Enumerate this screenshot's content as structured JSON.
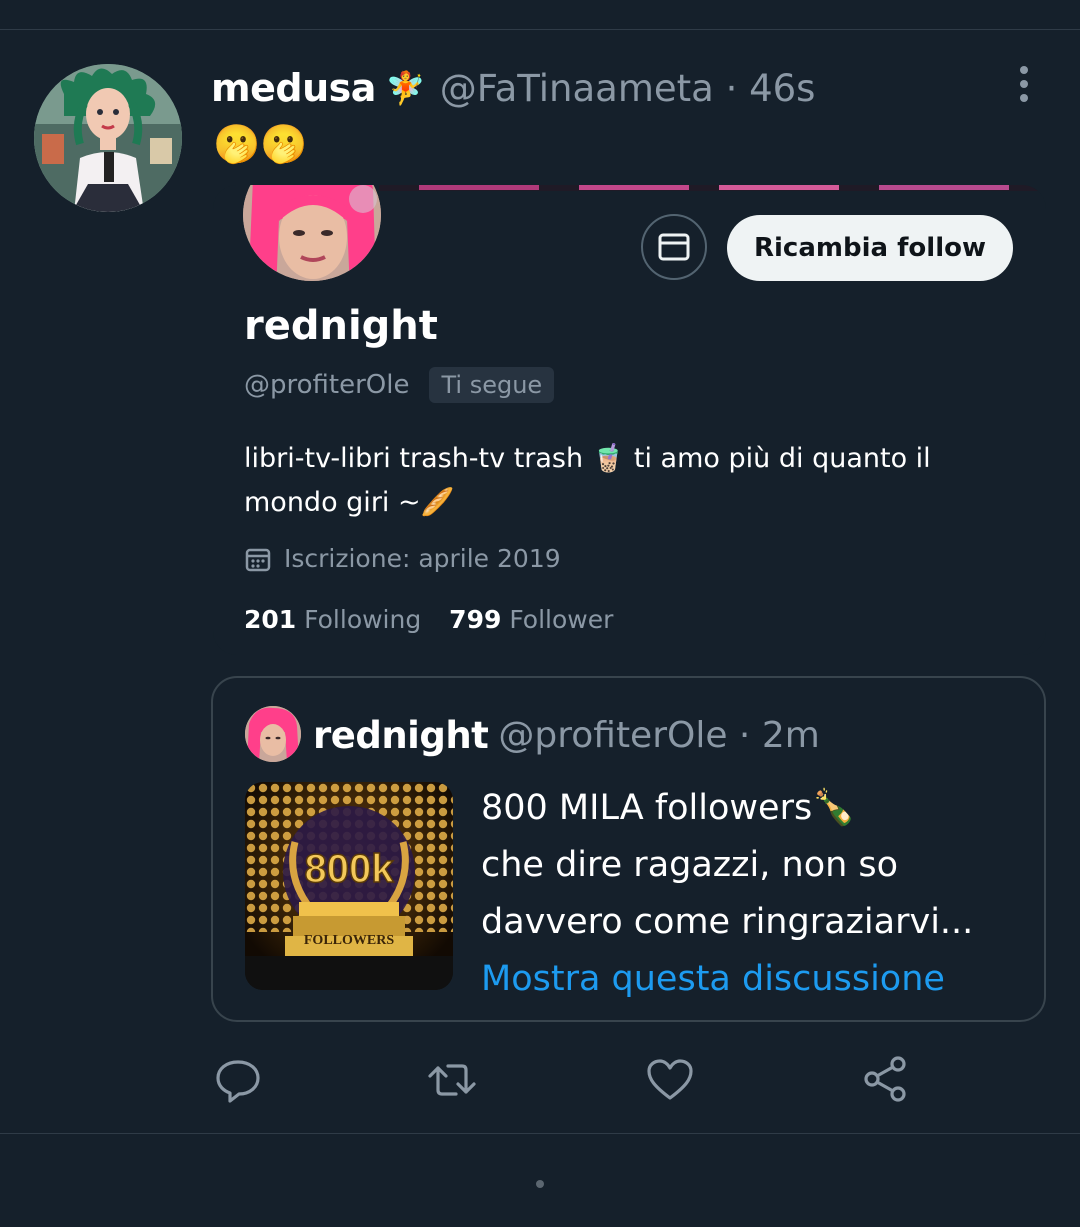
{
  "tweet": {
    "author_name": "medusa",
    "author_emoji": "🧚",
    "handle_time": "@FaTinaameta · 46s",
    "text": "🫢🫢",
    "more_icon": "more-vertical-icon"
  },
  "profile_card": {
    "name": "rednight",
    "handle": "@profiterOle",
    "follows_you": "Ti segue",
    "follow_button": "Ricambia follow",
    "message_icon": "envelope-icon",
    "bio": "libri-tv-libri trash-tv trash 🧋 ti amo più di quanto il mondo giri ~🥖",
    "joined": "Iscrizione: aprile 2019",
    "following_count": "201",
    "following_label": "Following",
    "followers_count": "799",
    "followers_label": "Follower"
  },
  "quoted_tweet": {
    "author_name": "rednight",
    "handle_time": "@profiterOle · 2m",
    "media_text_big": "800k",
    "media_text_small": "FOLLOWERS",
    "line1": "800 MILA followers🍾",
    "line2": "che dire ragazzi, non so",
    "line3": "davvero come ringraziarvi...",
    "show_thread": "Mostra questa discussione"
  },
  "actions": {
    "reply_icon": "reply-icon",
    "retweet_icon": "retweet-icon",
    "like_icon": "heart-icon",
    "share_icon": "share-icon"
  },
  "colors": {
    "background": "#15202b",
    "secondary_text": "#8b98a5",
    "link": "#1d9bf0",
    "border": "#38444d"
  }
}
